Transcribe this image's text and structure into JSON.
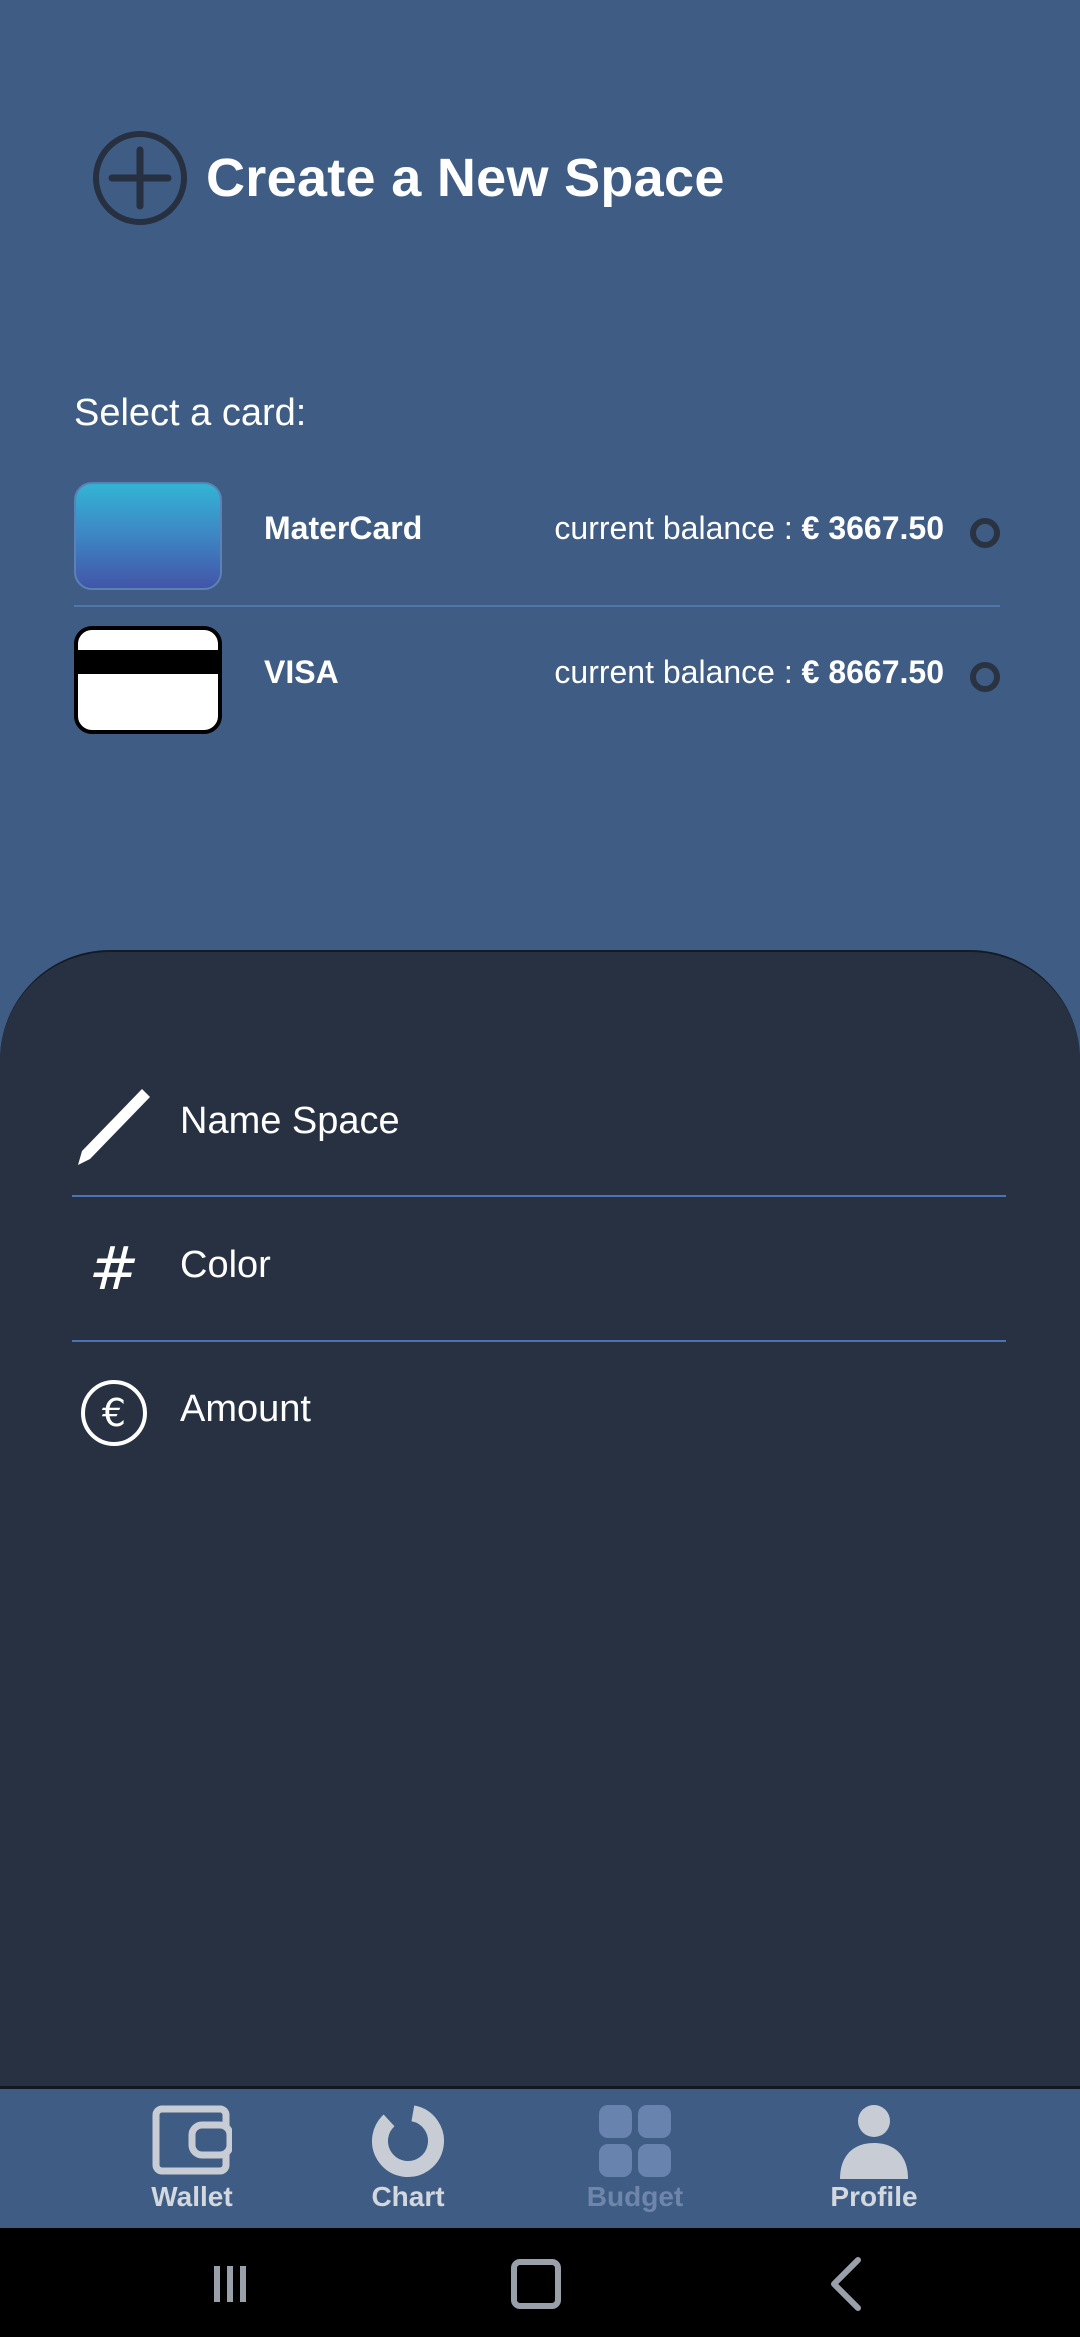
{
  "header": {
    "title": "Create a New Space",
    "icon": "plus-circle-icon"
  },
  "card_select": {
    "label": "Select a card:",
    "cards": [
      {
        "name": "MaterCard",
        "balance_prefix": "current balance :",
        "balance_amount": "€ 3667.50",
        "thumb_icon": "mastercard-thumbnail",
        "selected": false
      },
      {
        "name": "VISA",
        "balance_prefix": "current balance :",
        "balance_amount": "€ 8667.50",
        "thumb_icon": "visa-card-thumbnail",
        "selected": false
      }
    ]
  },
  "form": {
    "fields": [
      {
        "label": "Name Space",
        "icon": "pencil-icon"
      },
      {
        "label": "Color",
        "icon": "hash-icon",
        "glyph": "#"
      },
      {
        "label": "Amount",
        "icon": "euro-circle-icon",
        "glyph": "€"
      }
    ]
  },
  "nav": {
    "items": [
      {
        "label": "Wallet",
        "icon": "wallet-icon",
        "active": false
      },
      {
        "label": "Chart",
        "icon": "donut-chart-icon",
        "active": false
      },
      {
        "label": "Budget",
        "icon": "grid-icon",
        "active": true
      },
      {
        "label": "Profile",
        "icon": "person-icon",
        "active": false
      }
    ]
  },
  "system_nav": {
    "buttons": [
      "recents-icon",
      "home-icon",
      "back-icon"
    ]
  },
  "colors": {
    "background": "#3f5d84",
    "sheet": "#283141",
    "divider": "#4e73b4",
    "nav_active": "#6f86aa",
    "nav_inactive": "#d3d7de"
  }
}
